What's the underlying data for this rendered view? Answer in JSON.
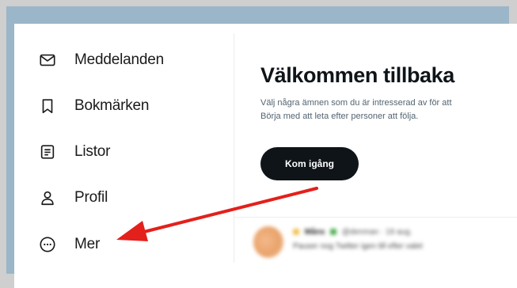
{
  "sidebar": {
    "items": [
      {
        "label": "Meddelanden",
        "icon": "mail-icon"
      },
      {
        "label": "Bokmärken",
        "icon": "bookmark-icon"
      },
      {
        "label": "Listor",
        "icon": "list-icon"
      },
      {
        "label": "Profil",
        "icon": "person-icon"
      },
      {
        "label": "Mer",
        "icon": "more-circle-icon"
      }
    ]
  },
  "main": {
    "title": "Välkommen tillbaka",
    "text_lines": [
      "Välj några ämnen som du är intresserad av för att",
      "Börja med att leta efter personer att följa."
    ],
    "cta_label": "Kom igång",
    "tweet": {
      "name": "Måns",
      "handle": "@denman · 19 aug.",
      "text": "Pauser nog Twitter igen till efter valet"
    }
  },
  "colors": {
    "background_frame": "#cfcfcf",
    "blue_panel": "#9ab6c8",
    "cta_background": "#0f1419",
    "arrow": "#e3201b"
  },
  "annotation": {
    "arrow_points_to": "Mer"
  }
}
